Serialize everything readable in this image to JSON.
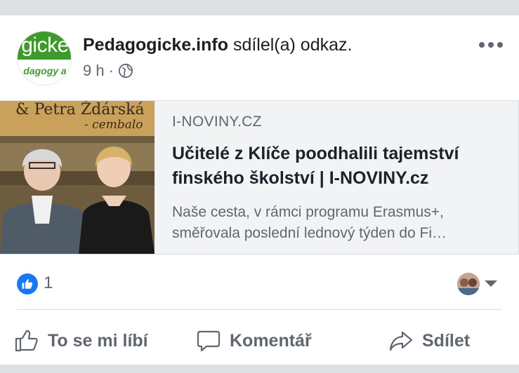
{
  "page": {
    "author": "Pedagogicke.info",
    "action": "sdílel(a) odkaz.",
    "time": "9 h",
    "dot": "·",
    "avatar_top_text": "gicke",
    "avatar_bottom_text": "dagogy a"
  },
  "link_card": {
    "image_caption_line1": "& Petra Ždárská",
    "image_caption_line2": "- cembalo",
    "domain": "I-NOVINY.CZ",
    "title": "Učitelé z Klíče poodhalili tajemství finského školství | I-NOVINY.cz",
    "description": "Naše cesta, v rámci programu Erasmus+, směřovala poslední lednový týden do Fi…"
  },
  "reactions": {
    "count": "1",
    "icon": "like-icon"
  },
  "actions": {
    "like_label": "To se mi líbí",
    "comment_label": "Komentář",
    "share_label": "Sdílet"
  },
  "colors": {
    "accent_blue": "#1877f2",
    "avatar_green": "#3f9a2d",
    "secondary_text": "#606770",
    "divider": "#dddfe2"
  }
}
